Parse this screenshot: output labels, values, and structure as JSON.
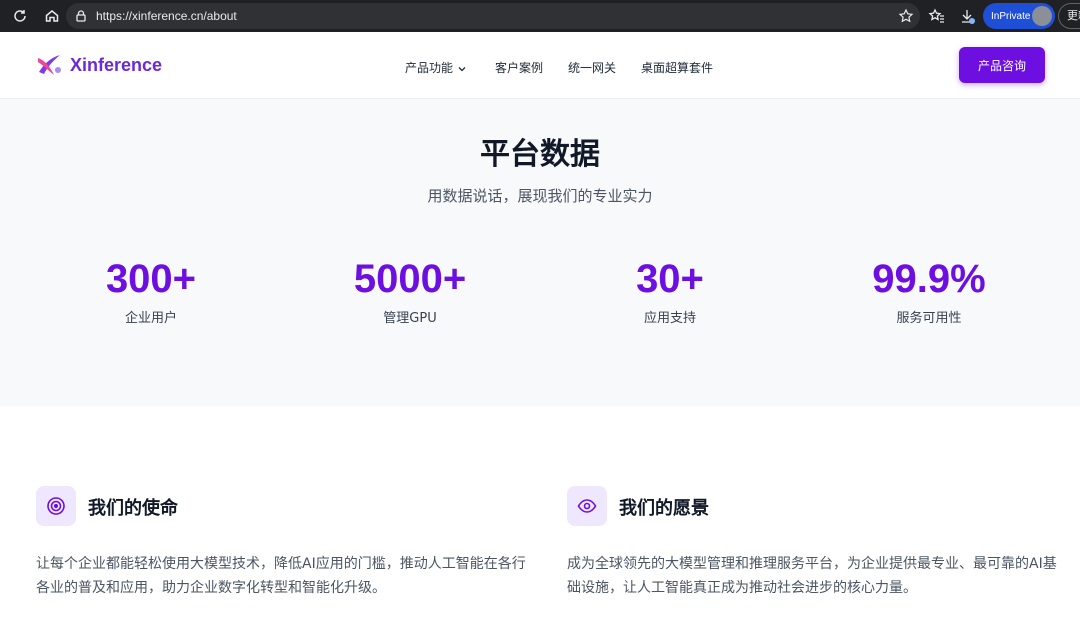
{
  "browser": {
    "url": "https://xinference.cn/about",
    "inprivate_label": "InPrivate",
    "more_label": "更新"
  },
  "header": {
    "logo_text": "Xinference",
    "nav": [
      {
        "label": "产品功能"
      },
      {
        "label": "客户案例"
      },
      {
        "label": "统一网关"
      },
      {
        "label": "桌面超算套件"
      }
    ],
    "cta_label": "产品咨询"
  },
  "stats": {
    "title": "平台数据",
    "subtitle": "用数据说话，展现我们的专业实力",
    "items": [
      {
        "value": "300+",
        "label": "企业用户"
      },
      {
        "value": "5000+",
        "label": "管理GPU"
      },
      {
        "value": "30+",
        "label": "应用支持"
      },
      {
        "value": "99.9%",
        "label": "服务可用性"
      }
    ]
  },
  "mission": {
    "title": "我们的使命",
    "text": "让每个企业都能轻松使用大模型技术，降低AI应用的门槛，推动人工智能在各行各业的普及和应用，助力企业数字化转型和智能化升级。",
    "icon": "target-icon"
  },
  "vision": {
    "title": "我们的愿景",
    "text": "成为全球领先的大模型管理和推理服务平台，为企业提供最专业、最可靠的AI基础设施，让人工智能真正成为推动社会进步的核心力量。",
    "icon": "eye-icon"
  },
  "colors": {
    "accent": "#6d0fe0",
    "stats_bg": "#f8f9fb",
    "icon_bg": "#efe7fd"
  }
}
